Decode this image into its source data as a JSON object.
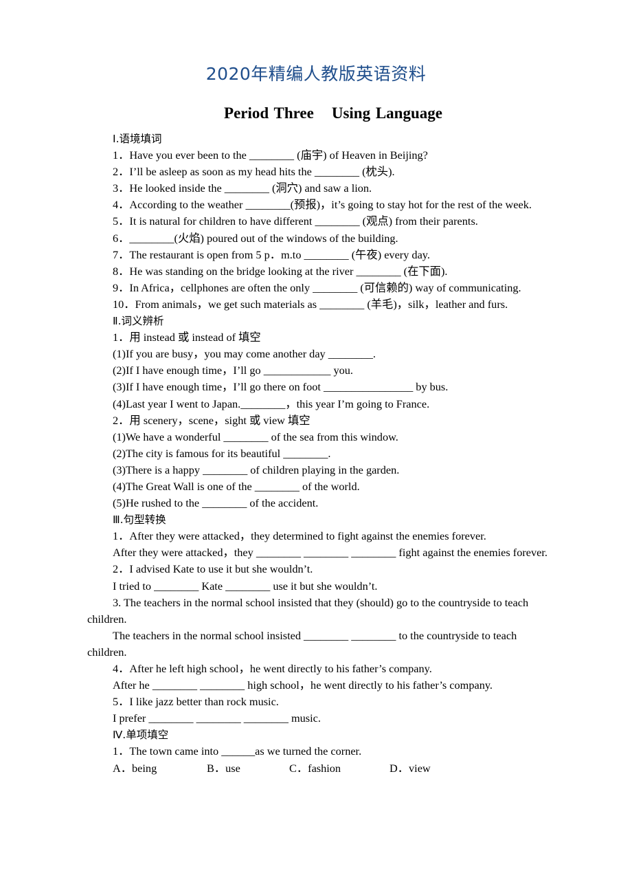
{
  "banner": "2020年精编人教版英语资料",
  "title": {
    "part1": "Period Three",
    "part2": "Using Language"
  },
  "sections": {
    "s1": {
      "heading": "Ⅰ.语境填词",
      "items": [
        "1．Have you ever been to the ________ (庙宇) of Heaven in Beijing?",
        "2．I’ll be asleep as soon as my head hits the ________ (枕头).",
        "3．He looked inside the ________ (洞穴) and saw a lion.",
        "4．According to the weather ________(预报)，it’s going to stay hot for the rest of the week.",
        "5．It is natural for children to have different ________ (观点) from their parents.",
        "6．________(火焰) poured out of the windows of the building.",
        "7．The restaurant is open from 5 p．m.to ________ (午夜) every day.",
        "8．He was standing on the bridge looking at the river ________ (在下面).",
        "9．In Africa，cellphones are often the only ________ (可信赖的) way of communicating.",
        "10．From animals，we get such materials as ________ (羊毛)，silk，leather and furs."
      ]
    },
    "s2": {
      "heading": "Ⅱ.词义辨析",
      "group1": {
        "prompt": "1．用 instead 或 instead of 填空",
        "items": [
          "(1)If you are busy，you may come another day ________.",
          "(2)If I have enough time，I’ll go ____________ you.",
          "(3)If I have enough time，I’ll go there on foot ________________ by bus.",
          "(4)Last year I went to Japan.________，this year I’m going to France."
        ]
      },
      "group2": {
        "prompt": "2．用 scenery，scene，sight 或 view 填空",
        "items": [
          "(1)We have a wonderful ________ of the sea from this window.",
          "(2)The city is famous for its beautiful ________.",
          "(3)There is a happy ________ of children playing in the garden.",
          "(4)The Great Wall is one of the ________ of the world.",
          "(5)He rushed to the ________ of the accident."
        ]
      }
    },
    "s3": {
      "heading": "Ⅲ.句型转换",
      "items": [
        {
          "original": "1．After they were attacked，they determined to fight against the enemies forever.",
          "rewrite": "After they were attacked，they ________ ________ ________ fight against the enemies forever."
        },
        {
          "original": "2．I advised Kate to use it but she wouldn’t.",
          "rewrite": "I tried to ________ Kate ________ use it but she wouldn’t."
        },
        {
          "original": "3. The teachers in the normal school insisted that they (should) go to the countryside to teach children.",
          "rewrite": "The teachers in the normal school insisted ________ ________ to the countryside to teach children."
        },
        {
          "original": "4．After he left high school，he went directly to his father’s company.",
          "rewrite": "After he ________ ________ high school，he went directly to his father’s company."
        },
        {
          "original": "5．I like jazz better than rock music.",
          "rewrite": "I prefer ________ ________ ________ music."
        }
      ]
    },
    "s4": {
      "heading": "Ⅳ.单项填空",
      "items": [
        {
          "question": "1．The town came into ______as we turned the corner.",
          "options": [
            "A．being",
            "B．use",
            "C．fashion",
            "D．view"
          ]
        }
      ]
    }
  }
}
